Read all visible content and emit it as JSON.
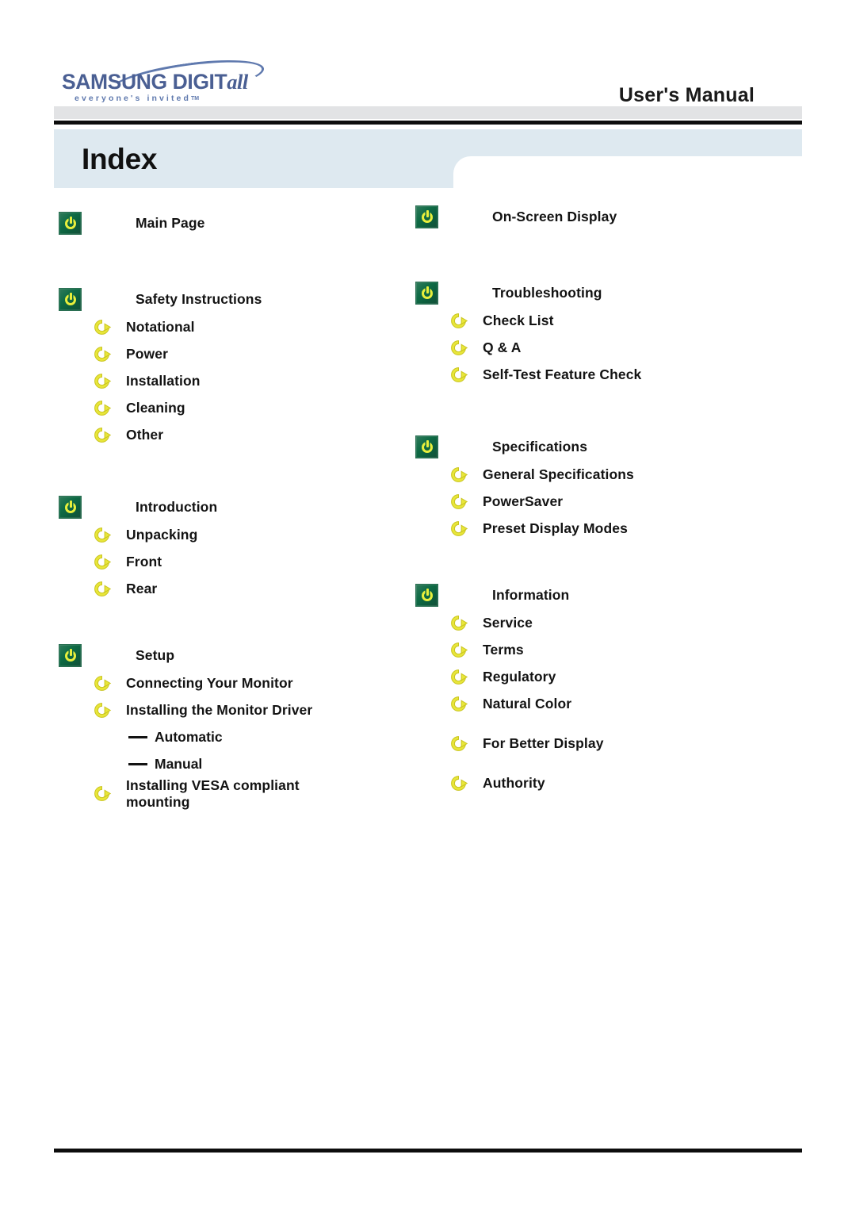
{
  "header": {
    "logo_wordmark_main": "SAMSUNG DIGIT",
    "logo_wordmark_italic": "all",
    "logo_tagline": "everyone's invited",
    "logo_tagline_tm": "TM",
    "manual_title": "User's Manual"
  },
  "page_title": "Index",
  "colors": {
    "tab_band": "#dee9f0",
    "grey_strip": "#e2e3e5",
    "rule": "#0d0d0d",
    "logo_blue": "#4a5f93",
    "icon_green": "#0f6b45",
    "icon_yellow": "#e8ef3c",
    "arrow_yellow": "#e6e233"
  },
  "icons": {
    "section": "power-icon",
    "item": "circular-arrow-icon",
    "subitem": "em-dash-marker"
  },
  "columns": {
    "left": [
      {
        "label": "Main Page",
        "icon": "power-icon",
        "items": []
      },
      {
        "label": "Safety Instructions",
        "icon": "power-icon",
        "items": [
          {
            "label": "Notational",
            "icon": "circular-arrow-icon"
          },
          {
            "label": "Power",
            "icon": "circular-arrow-icon"
          },
          {
            "label": "Installation",
            "icon": "circular-arrow-icon"
          },
          {
            "label": "Cleaning",
            "icon": "circular-arrow-icon"
          },
          {
            "label": "Other",
            "icon": "circular-arrow-icon"
          }
        ]
      },
      {
        "label": "Introduction",
        "icon": "power-icon",
        "items": [
          {
            "label": "Unpacking",
            "icon": "circular-arrow-icon"
          },
          {
            "label": "Front",
            "icon": "circular-arrow-icon"
          },
          {
            "label": "Rear",
            "icon": "circular-arrow-icon"
          }
        ]
      },
      {
        "label": "Setup",
        "icon": "power-icon",
        "items": [
          {
            "label": "Connecting Your Monitor",
            "icon": "circular-arrow-icon"
          },
          {
            "label": "Installing the Monitor Driver",
            "icon": "circular-arrow-icon"
          },
          {
            "label": "Automatic",
            "icon": "em-dash-marker",
            "level": "dash"
          },
          {
            "label": "Manual",
            "icon": "em-dash-marker",
            "level": "dash"
          },
          {
            "label": "Installing VESA compliant mounting",
            "icon": "circular-arrow-icon",
            "wrap": true
          }
        ]
      }
    ],
    "right": [
      {
        "label": "On-Screen Display",
        "icon": "power-icon",
        "items": []
      },
      {
        "label": "Troubleshooting",
        "icon": "power-icon",
        "items": [
          {
            "label": "Check List",
            "icon": "circular-arrow-icon"
          },
          {
            "label": "Q & A",
            "icon": "circular-arrow-icon"
          },
          {
            "label": "Self-Test Feature Check",
            "icon": "circular-arrow-icon"
          }
        ]
      },
      {
        "label": "Specifications",
        "icon": "power-icon",
        "items": [
          {
            "label": "General Specifications",
            "icon": "circular-arrow-icon"
          },
          {
            "label": "PowerSaver",
            "icon": "circular-arrow-icon"
          },
          {
            "label": "Preset Display Modes",
            "icon": "circular-arrow-icon"
          }
        ]
      },
      {
        "label": "Information",
        "icon": "power-icon",
        "items": [
          {
            "label": "Service",
            "icon": "circular-arrow-icon"
          },
          {
            "label": "Terms",
            "icon": "circular-arrow-icon"
          },
          {
            "label": "Regulatory",
            "icon": "circular-arrow-icon"
          },
          {
            "label": "Natural Color",
            "icon": "circular-arrow-icon"
          },
          {
            "label": "For Better Display",
            "icon": "circular-arrow-icon",
            "gap_before": true
          },
          {
            "label": "Authority",
            "icon": "circular-arrow-icon",
            "gap_before": true
          }
        ]
      }
    ]
  }
}
